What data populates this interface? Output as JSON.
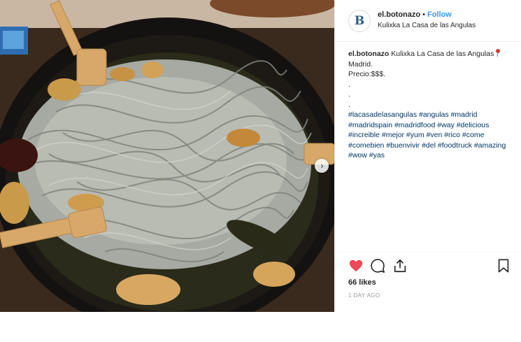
{
  "post": {
    "username": "el.botonazo",
    "follow_label": "Follow",
    "dot": "•",
    "location": "Kulixka La Casa de las Angulas",
    "avatar_letter": "B"
  },
  "caption": {
    "username": "el.botonazo",
    "place": "Kulixka La Casa de las Angulas",
    "city": "Madrid.",
    "price": "Precio:$$$.",
    "dots": [
      ".",
      ".",
      "."
    ],
    "hashtags": [
      "#lacasadelasangulas",
      "#angulas",
      "#madrid",
      "#madridspain",
      "#madridfood",
      "#way",
      "#delicious",
      "#increible",
      "#mejor",
      "#yum",
      "#ven",
      "#rico",
      "#come",
      "#comebien",
      "#buenvivir",
      "#del",
      "#foodtruck",
      "#amazing",
      "#wow",
      "#yas"
    ]
  },
  "engagement": {
    "likes": "66 likes",
    "time": "1 DAY AGO",
    "like_color": "#ed4956"
  },
  "icons": {
    "like": "heart-icon",
    "comment": "comment-icon",
    "share": "share-icon",
    "save": "bookmark-icon",
    "next": "chevron-right-icon"
  },
  "carousel": {
    "next_glyph": "›"
  }
}
